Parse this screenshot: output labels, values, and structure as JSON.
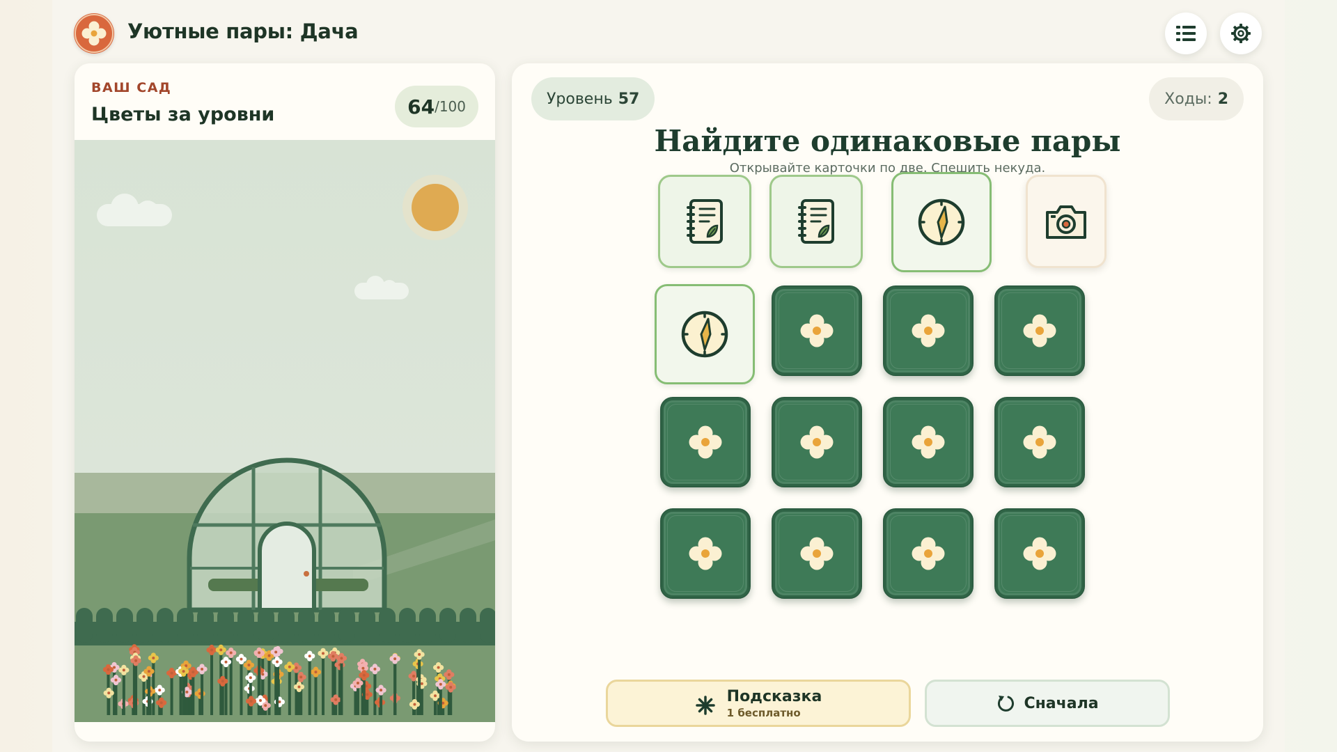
{
  "app": {
    "title": "Уютные пары: Дача",
    "accent": "#d9683d",
    "dark_green": "#1e3d2e",
    "menu_icon": "list-icon",
    "settings_icon": "gear-icon"
  },
  "garden": {
    "kicker": "ВАШ САД",
    "title": "Цветы за уровни",
    "progress_current": "64",
    "progress_max": "/100"
  },
  "board": {
    "level_label": "Уровень",
    "level_value": "57",
    "moves_label": "Ходы:",
    "moves_value": "2",
    "title": "Найдите одинаковые пары",
    "subtitle": "Открывайте карточки по две. Спешить некуда.",
    "cards": [
      {
        "state": "face",
        "icon": "notebook-icon"
      },
      {
        "state": "face",
        "icon": "notebook-icon"
      },
      {
        "state": "face-selected",
        "icon": "compass-icon"
      },
      {
        "state": "face-warm",
        "icon": "camera-icon"
      },
      {
        "state": "face-selected",
        "icon": "compass-icon"
      },
      {
        "state": "back",
        "icon": "flower-icon"
      },
      {
        "state": "back",
        "icon": "flower-icon"
      },
      {
        "state": "back",
        "icon": "flower-icon"
      },
      {
        "state": "back",
        "icon": "flower-icon"
      },
      {
        "state": "back",
        "icon": "flower-icon"
      },
      {
        "state": "back",
        "icon": "flower-icon"
      },
      {
        "state": "back",
        "icon": "flower-icon"
      },
      {
        "state": "back",
        "icon": "flower-icon"
      },
      {
        "state": "back",
        "icon": "flower-icon"
      },
      {
        "state": "back",
        "icon": "flower-icon"
      },
      {
        "state": "back",
        "icon": "flower-icon"
      }
    ]
  },
  "actions": {
    "hint_label": "Подсказка",
    "hint_sub": "1 бесплатно",
    "hint_icon": "sparkle-icon",
    "restart_label": "Сначала",
    "restart_icon": "restart-icon"
  }
}
